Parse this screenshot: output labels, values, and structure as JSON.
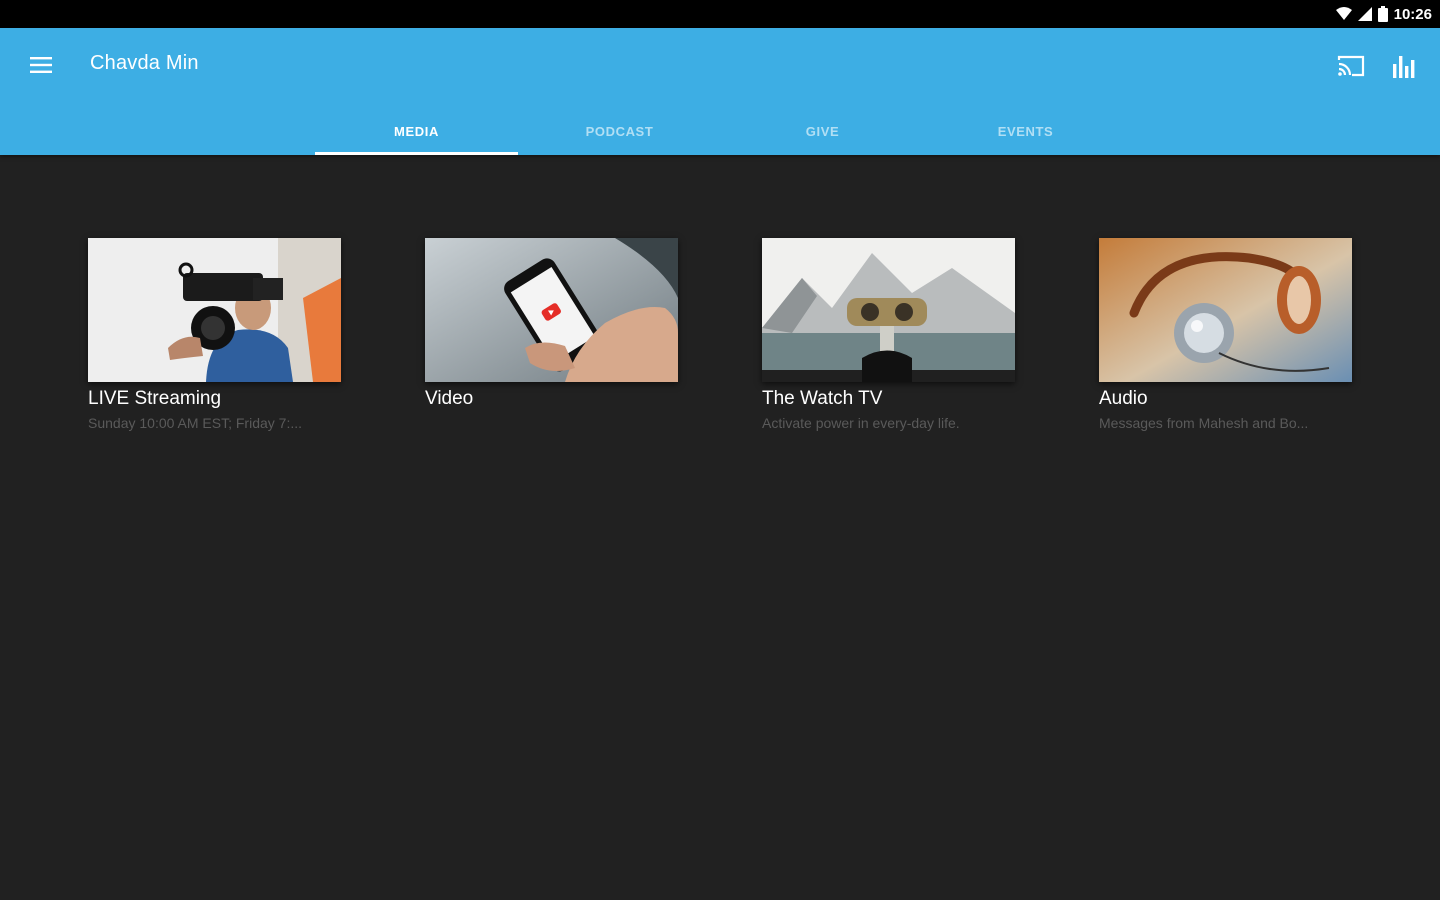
{
  "status_bar": {
    "time": "10:26",
    "icons": [
      "wifi-icon",
      "signal-icon",
      "battery-icon"
    ]
  },
  "app_bar": {
    "title": "Chavda Min",
    "background_color": "#3daee4",
    "menu_icon": "hamburger-menu-icon",
    "actions": [
      "cast-icon",
      "bar-chart-icon"
    ]
  },
  "tabs": [
    {
      "label": "MEDIA",
      "active": true
    },
    {
      "label": "PODCAST",
      "active": false
    },
    {
      "label": "GIVE",
      "active": false
    },
    {
      "label": "EVENTS",
      "active": false
    }
  ],
  "cards": [
    {
      "title": "LIVE Streaming",
      "subtitle": "Sunday 10:00 AM EST; Friday 7:...",
      "image": "videographer-camera"
    },
    {
      "title": "Video",
      "subtitle": "",
      "image": "hand-holding-phone-youtube"
    },
    {
      "title": "The Watch TV",
      "subtitle": "Activate power in every-day life.",
      "image": "binocular-viewer-mountain-lake"
    },
    {
      "title": "Audio",
      "subtitle": "Messages from Mahesh and Bo...",
      "image": "headphones"
    }
  ]
}
